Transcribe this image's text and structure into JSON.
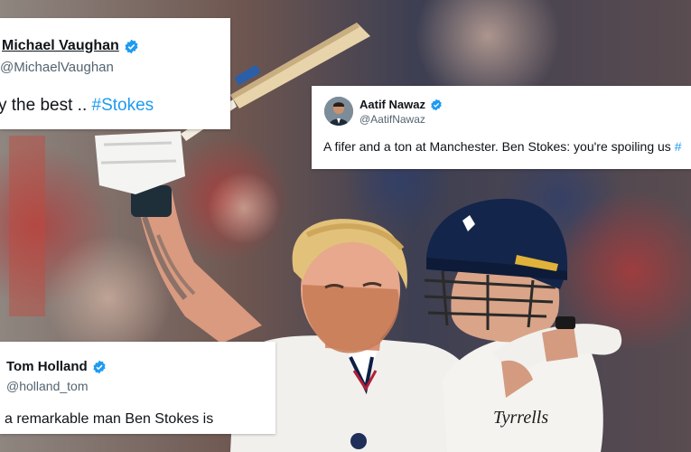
{
  "photo": {
    "description_icon": "cricket-celebration-photo",
    "shirt_sponsor": "Tyrrells"
  },
  "tweets": [
    {
      "name": "Michael Vaughan",
      "handle": "@MichaelVaughan",
      "text": "y the best .. ",
      "hashtag": "#Stokes",
      "verified": true
    },
    {
      "name": "Aatif Nawaz",
      "handle": "@AatifNawaz",
      "text": "A fifer and a ton at Manchester. Ben Stokes: you're spoiling us ",
      "hashtag": "#",
      "verified": true
    },
    {
      "name": "Tom Holland",
      "handle": "@holland_tom",
      "text": "a remarkable man Ben Stokes is",
      "verified": true
    }
  ],
  "colors": {
    "verified": "#1d9bf0",
    "hashtag": "#1d9bf0",
    "handle": "#536471"
  }
}
